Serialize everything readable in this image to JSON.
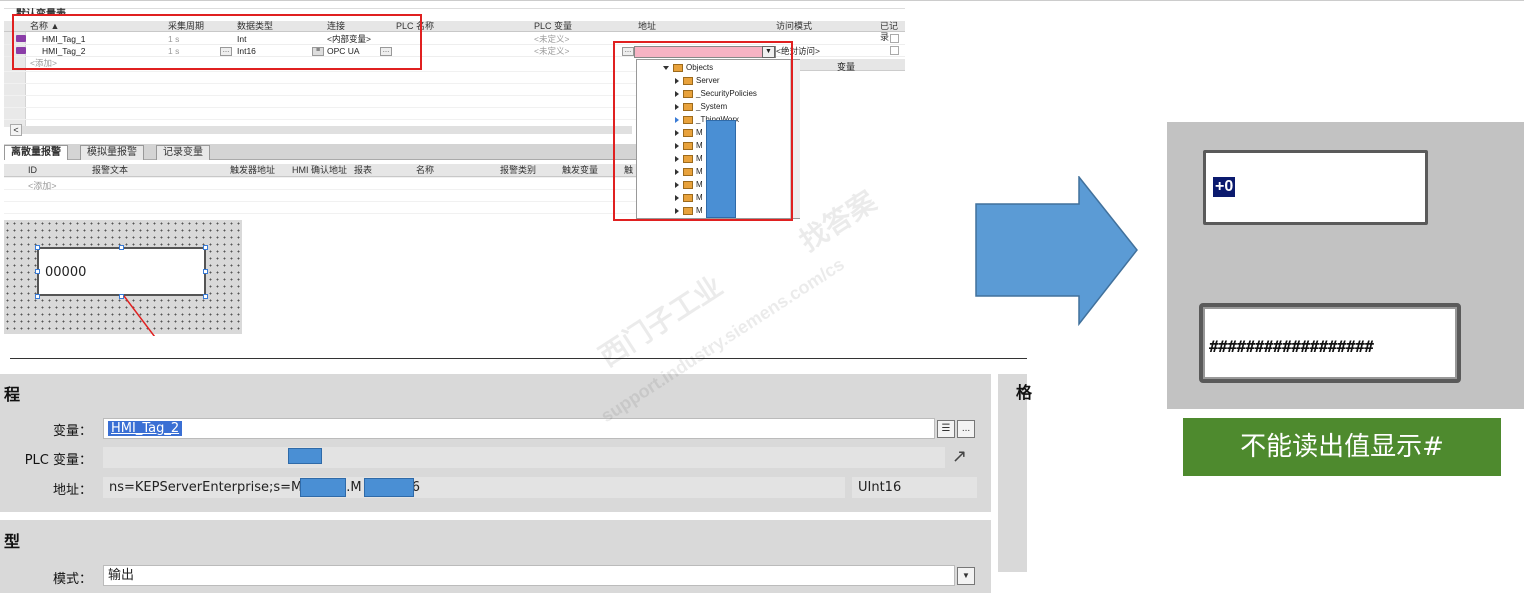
{
  "tag_table": {
    "title": "默认变量表",
    "columns": [
      "名称 ▲",
      "采集周期",
      "数据类型",
      "连接",
      "PLC 名称",
      "PLC 变量",
      "地址",
      "访问模式",
      "已记录"
    ],
    "rows": [
      {
        "name": "HMI_Tag_1",
        "cycle": "1 s",
        "type": "Int",
        "connection": "<内部变量>",
        "plc_tag": "<未定义>"
      },
      {
        "name": "HMI_Tag_2",
        "cycle": "1 s",
        "type": "Int16",
        "connection": "OPC UA",
        "plc_tag": "<未定义>",
        "access": "<绝对访问>"
      }
    ],
    "add_row": "<添加>",
    "scroll_left": "<"
  },
  "address_dropdown": {
    "items": [
      "Objects",
      "Server",
      "_SecurityPolicies",
      "_System",
      "_ThingWorx",
      "M",
      "M",
      "M",
      "M",
      "M",
      "M",
      "M"
    ],
    "right_header": "变量",
    "arrow": "▼"
  },
  "alarm_tabs": {
    "tabs": [
      "离散量报警",
      "模拟量报警",
      "记录变量"
    ],
    "columns": [
      "ID",
      "报警文本",
      "触发器地址",
      "HMI 确认地址",
      "报表",
      "名称",
      "报警类别",
      "触发变量",
      "触"
    ],
    "add_row": "<添加>"
  },
  "io_field": {
    "value": "00000"
  },
  "properties": {
    "section_process": "程",
    "tag_label": "变量：",
    "tag_value": "HMI_Tag_2",
    "plc_tag_label": "PLC 变量：",
    "address_label": "地址：",
    "address_prefix": "ns=KEPServerEnterprise;s=M",
    "address_mid": ".M",
    "address_suffix": ".6",
    "address_type": "UInt16",
    "section_type": "型",
    "mode_label": "模式：",
    "mode_value": "输出",
    "side_title": "格",
    "ellipsis": "...",
    "link_arrow": "↗"
  },
  "result": {
    "field1_value": "+0",
    "field2_value": "##################",
    "caption": "不能读出值显示#"
  },
  "watermark": {
    "line1": "西门子工业",
    "line2": "找答案",
    "line3": "support.industry.siemens.com/cs"
  },
  "colors": {
    "highlight_red": "#e02020",
    "arrow_blue": "#5b9bd5",
    "caption_green": "#4e8a2e",
    "address_pink": "#f7b3c4"
  }
}
